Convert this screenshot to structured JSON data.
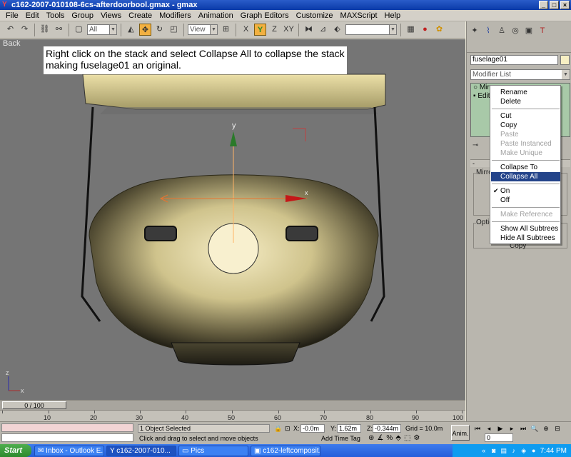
{
  "window": {
    "title": "c162-2007-010108-6cs-afterdoorbool.gmax - gmax",
    "minimize": "_",
    "maximize": "□",
    "close": "×"
  },
  "menubar": {
    "items": [
      "File",
      "Edit",
      "Tools",
      "Group",
      "Views",
      "Create",
      "Modifiers",
      "Animation",
      "Graph Editors",
      "Customize",
      "MAXScript",
      "Help"
    ]
  },
  "toolbar": {
    "selection_filter": "All",
    "ref_coord": "View",
    "named_selection": ""
  },
  "viewport": {
    "label": "Back",
    "note": "Right click on the stack and select Collapse All to collapse the stack making fuselage01 an original.",
    "gizmo_y_label": "y",
    "gizmo_x_label": "x",
    "axis_tripod_z": "z",
    "axis_tripod_x": "x"
  },
  "command_panel": {
    "object_name": "fuselage01",
    "object_color": "#f7efc3",
    "modifier_list": "Modifier List",
    "stack_items": [
      "Mirror",
      "Edit"
    ],
    "stack_bg_color": "#a8c9a8",
    "rollout_title": "Mirror",
    "group_mirror_axis": "Mirro",
    "group_options": "Optio",
    "copy_label": "Copy"
  },
  "context_menu": {
    "items": [
      {
        "label": "Rename",
        "disabled": false
      },
      {
        "label": "Delete",
        "disabled": false
      },
      {
        "label": "Cut",
        "disabled": false
      },
      {
        "label": "Copy",
        "disabled": false
      },
      {
        "label": "Paste",
        "disabled": true
      },
      {
        "label": "Paste Instanced",
        "disabled": true
      },
      {
        "label": "Make Unique",
        "disabled": true
      },
      {
        "label": "Collapse To",
        "disabled": false
      },
      {
        "label": "Collapse All",
        "disabled": false,
        "selected": true
      },
      {
        "label": "On",
        "disabled": false,
        "checked": true
      },
      {
        "label": "Off",
        "disabled": false
      },
      {
        "label": "Make Reference",
        "disabled": true
      },
      {
        "label": "Show All Subtrees",
        "disabled": false
      },
      {
        "label": "Hide All Subtrees",
        "disabled": false
      }
    ],
    "highlight_color": "#24448a"
  },
  "timeline": {
    "frame_display": "0 / 100",
    "ticks": [
      "10",
      "20",
      "30",
      "40",
      "50",
      "60",
      "70",
      "80",
      "90",
      "100"
    ]
  },
  "statusbar": {
    "selection_status": "1 Object Selected",
    "prompt": "Click and drag to select and move objects",
    "x_label": "X:",
    "x_value": "-0.0m",
    "y_label": "Y:",
    "y_value": "1.62m",
    "z_label": "Z:",
    "z_value": "-0.344m",
    "grid": "Grid = 10.0m",
    "add_time_tag": "Add Time Tag",
    "anim_button": "Anim.",
    "current_frame": "0"
  },
  "taskbar": {
    "start_label": "Start",
    "tasks": [
      {
        "label": "Inbox - Outlook E...",
        "active": false
      },
      {
        "label": "c162-2007-010...",
        "active": true
      },
      {
        "label": "Pics",
        "active": false
      },
      {
        "label": "c162-leftcomposit...",
        "active": false
      }
    ],
    "time": "7:44 PM",
    "tray_arrow": "«"
  }
}
